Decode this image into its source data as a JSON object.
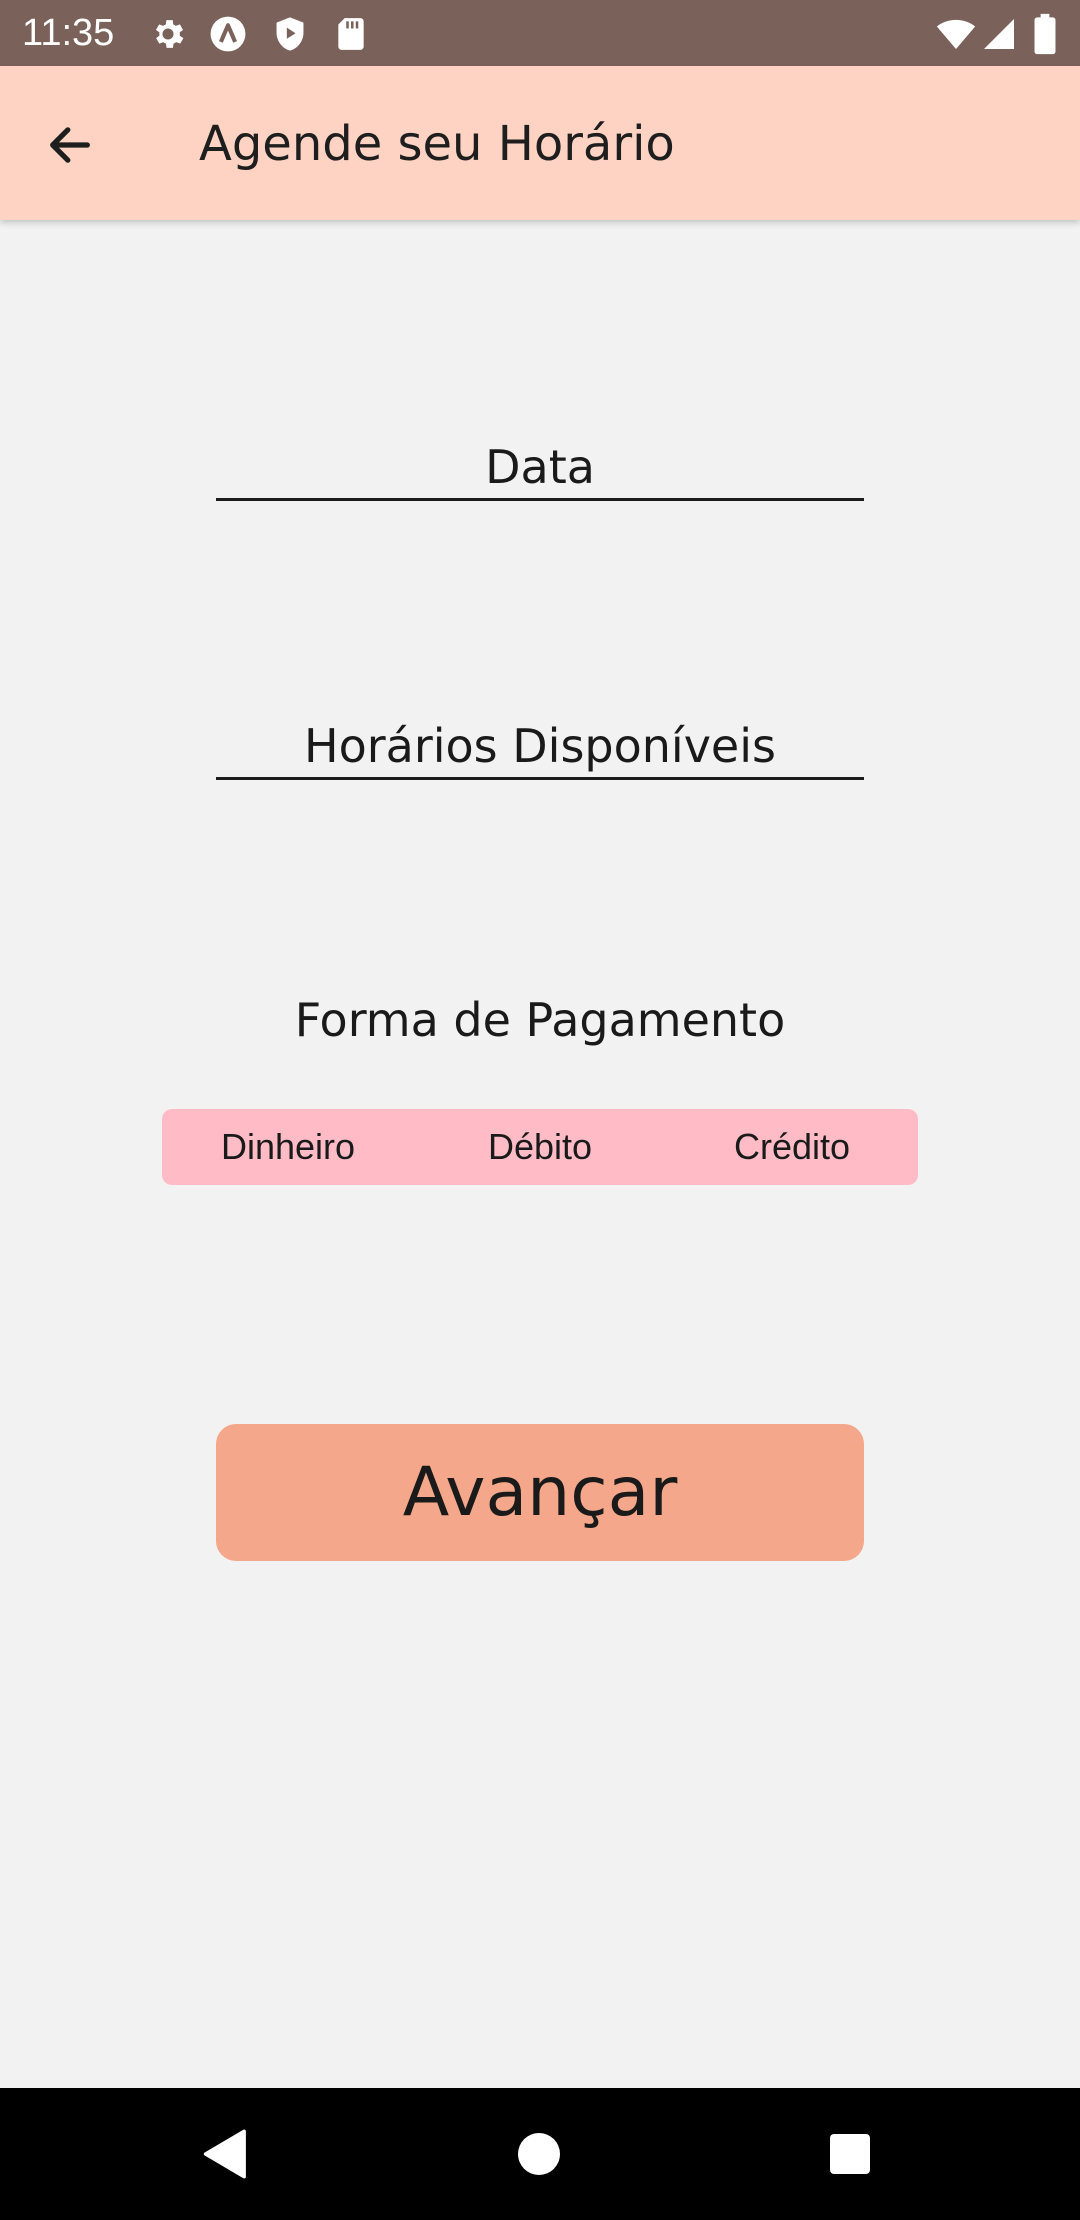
{
  "status_bar": {
    "time": "11:35",
    "left_icons": [
      "gear-icon",
      "a-badge-icon",
      "shield-play-icon",
      "sd-card-icon"
    ],
    "right_icons": [
      "wifi-icon",
      "cell-signal-icon",
      "battery-icon"
    ]
  },
  "app_bar": {
    "title": "Agende seu Horário",
    "background": "#ffd3c3"
  },
  "form": {
    "date_field": "Data",
    "times_field": "Horários Disponíveis",
    "payment_label": "Forma de Pagamento",
    "payment_options": [
      "Dinheiro",
      "Débito",
      "Crédito"
    ],
    "payment_background": "#ffbcc7"
  },
  "actions": {
    "advance_label": "Avançar",
    "advance_color": "#f4a78a"
  },
  "nav_bar": {
    "icons": [
      "back-triangle-icon",
      "home-circle-icon",
      "recents-square-icon"
    ]
  }
}
